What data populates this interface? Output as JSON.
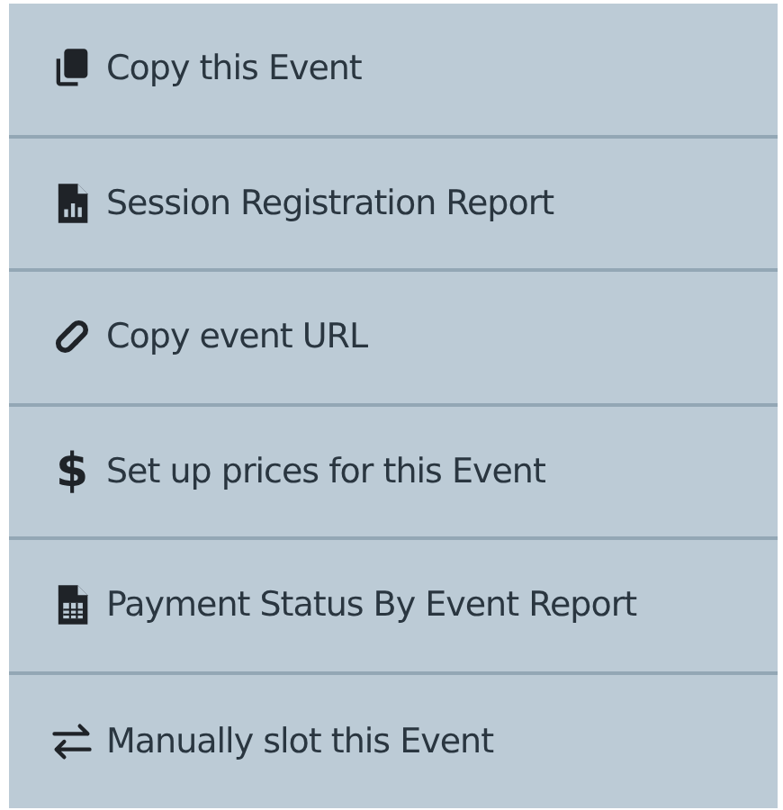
{
  "menu": {
    "items": [
      {
        "kind": "copy",
        "label": "Copy this Event"
      },
      {
        "kind": "report",
        "label": "Session Registration Report"
      },
      {
        "kind": "link",
        "label": "Copy event URL"
      },
      {
        "kind": "dollar",
        "glyph": "$",
        "label": "Set up prices for this Event"
      },
      {
        "kind": "calc",
        "label": "Payment Status By Event Report"
      },
      {
        "kind": "swap",
        "label": "Manually slot this Event"
      }
    ]
  }
}
